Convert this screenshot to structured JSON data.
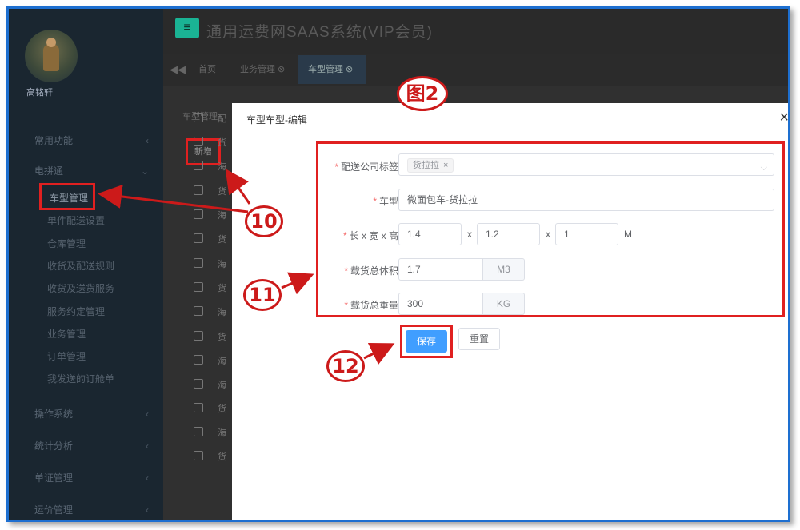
{
  "app": {
    "title": "通用运费网SAAS系统(VIP会员)",
    "menu_icon": "hamburger-icon",
    "accent": "#1ab394"
  },
  "user": {
    "name": "高铭轩"
  },
  "sidebar": {
    "sections": [
      {
        "label": "常用功能"
      },
      {
        "label": "电拼通"
      },
      {
        "label": "操作系统"
      },
      {
        "label": "统计分析"
      },
      {
        "label": "单证管理"
      },
      {
        "label": "运价管理"
      }
    ],
    "items": [
      {
        "label": "车型管理"
      },
      {
        "label": "单件配送设置"
      },
      {
        "label": "仓库管理"
      },
      {
        "label": "收货及配送规则"
      },
      {
        "label": "收货及送货服务"
      },
      {
        "label": "服务约定管理"
      },
      {
        "label": "业务管理"
      },
      {
        "label": "订单管理"
      },
      {
        "label": "我发送的订舱单"
      }
    ]
  },
  "tabs": [
    {
      "label": "首页"
    },
    {
      "label": "业务管理 ⊗"
    },
    {
      "label": "车型管理 ⊗"
    }
  ],
  "main": {
    "breadcrumb": "车型管理",
    "add_label": "新增",
    "rows": [
      "配",
      "货",
      "海",
      "货",
      "海",
      "货",
      "海",
      "货",
      "海",
      "货",
      "海",
      "海",
      "货",
      "海",
      "货"
    ]
  },
  "dialog": {
    "title": "车型车型-编辑",
    "close": "×",
    "fields": {
      "company_tag": {
        "label": "配送公司标签",
        "tag": "货拉拉",
        "tag_close": "×"
      },
      "vehicle_type": {
        "label": "车型",
        "value": "微面包车-货拉拉"
      },
      "dimensions": {
        "label": "长 x 宽 x 高",
        "length": "1.4",
        "width": "1.2",
        "height": "1",
        "sep": "x",
        "unit": "M"
      },
      "volume": {
        "label": "载货总体积",
        "value": "1.7",
        "unit": "M3"
      },
      "weight": {
        "label": "载货总重量",
        "value": "300",
        "unit": "KG"
      }
    },
    "save_label": "保存",
    "reset_label": "重置"
  },
  "annotations": {
    "figure": "图2",
    "markers": [
      "10",
      "11",
      "12"
    ],
    "color": "#cc1a1a"
  }
}
